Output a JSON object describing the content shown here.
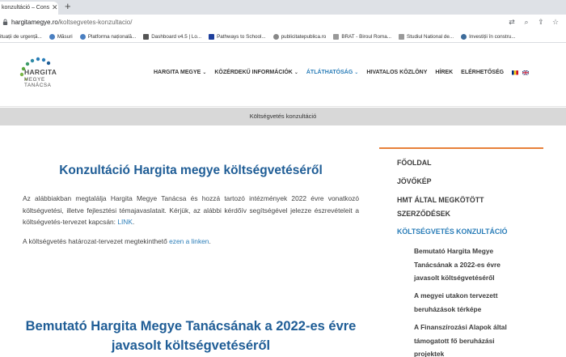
{
  "browser": {
    "tab_title": "konzultáció – Cons",
    "url_host": "hargitamegye.ro",
    "url_path": "/koltsegvetes-konzultacio/",
    "bookmarks": [
      {
        "label": "ituații de urgență..."
      },
      {
        "label": "Măsuri"
      },
      {
        "label": "Platforma națională..."
      },
      {
        "label": "Dashboard v4.5 | Lo..."
      },
      {
        "label": "Pathways to School..."
      },
      {
        "label": "publicitatepublica.ro"
      },
      {
        "label": "BRAT - Biroul Roma..."
      },
      {
        "label": "Studiul National de..."
      },
      {
        "label": "Investiții în constru..."
      }
    ]
  },
  "site": {
    "logo_name": "HARGITA",
    "logo_sub1": "MEGYE",
    "logo_sub2": "TANÁCSA",
    "nav": [
      {
        "label": "HARGITA MEGYE",
        "dropdown": true
      },
      {
        "label": "KÖZÉRDEKŰ INFORMÁCIÓK",
        "dropdown": true
      },
      {
        "label": "ÁTLÁTHATÓSÁG",
        "dropdown": true,
        "active": true
      },
      {
        "label": "HIVATALOS KÖZLÖNY",
        "dropdown": false
      },
      {
        "label": "HÍREK",
        "dropdown": false
      },
      {
        "label": "ELÉRHETŐSÉG",
        "dropdown": false
      }
    ],
    "strip_title": "Költségvetés konzultáció"
  },
  "main": {
    "title": "Konzultáció Hargita megye költségvetéséről",
    "para1_text": "Az alábbiakban megtalálja Hargita Megye Tanácsa és hozzá tartozó intézmények 2022 évre vonatkozó költségvetési, illetve fejlesztési témajavaslatait. Kérjük, az alábbi kérdőív segítségével jelezze észrevételeit a költségvetés-tervezet kapcsán: ",
    "para1_link": "LINK",
    "para1_end": ".",
    "para2_text": "A költségvetés határozat-tervezet megtekinthető ",
    "para2_link": "ezen a linken",
    "para2_end": ".",
    "subtitle_line1": "Bemutató Hargita Megye Tanácsának a 2022-es évre",
    "subtitle_line2": "javasolt költségvetéséről"
  },
  "sidebar": {
    "items": [
      {
        "label": "FŐOLDAL"
      },
      {
        "label": "JÖVŐKÉP"
      },
      {
        "label": "HMT ÁLTAL MEGKÖTÖTT"
      },
      {
        "label": "SZERZŐDÉSEK"
      },
      {
        "label": "KÖLTSÉGVETÉS KONZULTÁCIÓ",
        "active": true
      }
    ],
    "sub_items": [
      {
        "line1": "Bemutató Hargita Megye",
        "line2": "Tanácsának a 2022-es évre",
        "line3": "javasolt költségvetéséről"
      },
      {
        "line1": "A megyei utakon tervezett",
        "line2": "beruházások térképe"
      },
      {
        "line1": "A Finanszírozási Alapok által",
        "line2": "támogatott fő beruházási",
        "line3": "projektek"
      }
    ]
  },
  "colors": {
    "accent_blue": "#2a7db8",
    "title_blue": "#1f5d96",
    "sidebar_rule": "#e8803a",
    "strip_grey": "#d8d8d8"
  }
}
